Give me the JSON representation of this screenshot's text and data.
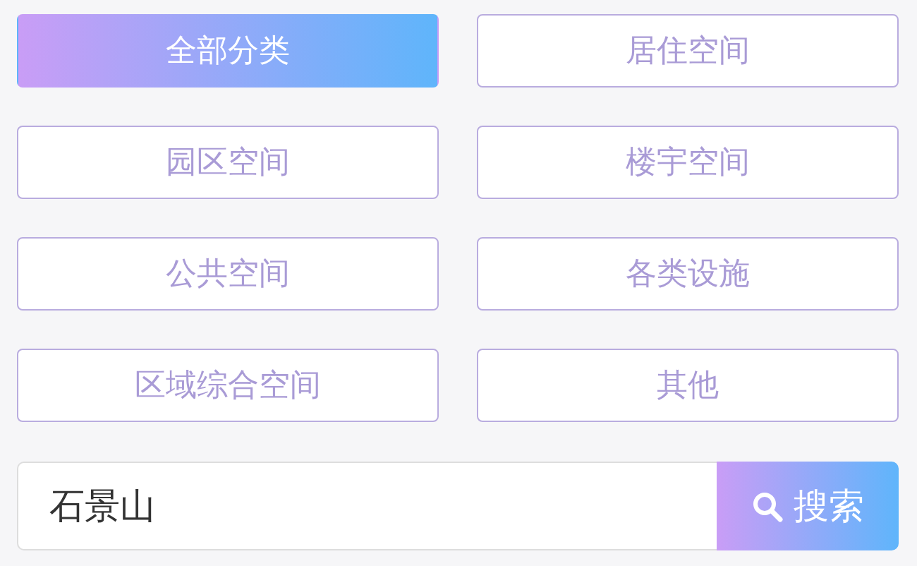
{
  "categories": [
    {
      "label": "全部分类",
      "selected": true
    },
    {
      "label": "居住空间",
      "selected": false
    },
    {
      "label": "园区空间",
      "selected": false
    },
    {
      "label": "楼宇空间",
      "selected": false
    },
    {
      "label": "公共空间",
      "selected": false
    },
    {
      "label": "各类设施",
      "selected": false
    },
    {
      "label": "区域综合空间",
      "selected": false
    },
    {
      "label": "其他",
      "selected": false
    }
  ],
  "search": {
    "value": "石景山",
    "button": "搜索"
  }
}
